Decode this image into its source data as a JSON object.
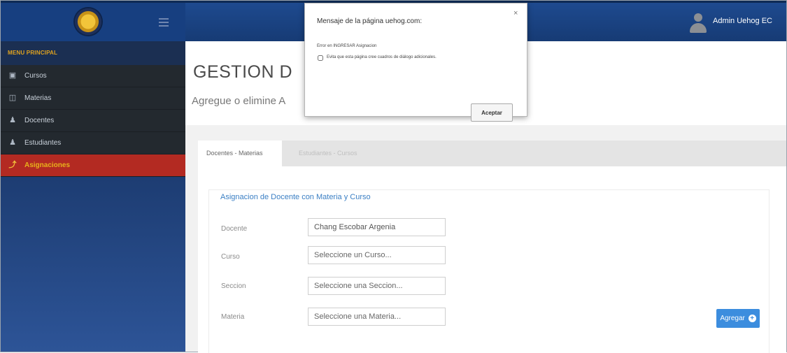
{
  "navbar": {
    "user_name": "Admin Uehog EC"
  },
  "sidebar": {
    "header": "MENU PRINCIPAL",
    "items": [
      {
        "label": "Cursos",
        "icon": "calendar-icon"
      },
      {
        "label": "Materias",
        "icon": "book-icon"
      },
      {
        "label": "Docentes",
        "icon": "user-icon"
      },
      {
        "label": "Estudiantes",
        "icon": "user-icon"
      },
      {
        "label": "Asignaciones",
        "icon": "link-icon",
        "active": true
      }
    ]
  },
  "header": {
    "title": "GESTION D",
    "subtitle": "Agregue o elimine A"
  },
  "tabs": [
    {
      "label": "Docentes - Materias",
      "active": true
    },
    {
      "label": "Estudiantes - Cursos",
      "active": false
    }
  ],
  "form": {
    "title": "Asignacion de Docente con Materia y Curso",
    "fields": [
      {
        "label": "Docente",
        "value": "Chang Escobar Argenia",
        "placeholder": ""
      },
      {
        "label": "Curso",
        "value": "",
        "placeholder": "Seleccione un Curso..."
      },
      {
        "label": "Seccion",
        "value": "",
        "placeholder": "Seleccione una Seccion..."
      },
      {
        "label": "Materia",
        "value": "",
        "placeholder": "Seleccione una Materia..."
      }
    ],
    "add_label": "Agregar"
  },
  "dialog": {
    "title": "Mensaje de la página uehog.com:",
    "close": "×",
    "message": "Error en INGRESAR Asignacion",
    "checkbox_label": "Evita que esta página cree cuadros de diálogo adicionales.",
    "ok_label": "Aceptar"
  },
  "colors": {
    "navbar": "#1e4a8f",
    "sidebar_active": "#b32a22",
    "accent": "#3c8dde"
  }
}
